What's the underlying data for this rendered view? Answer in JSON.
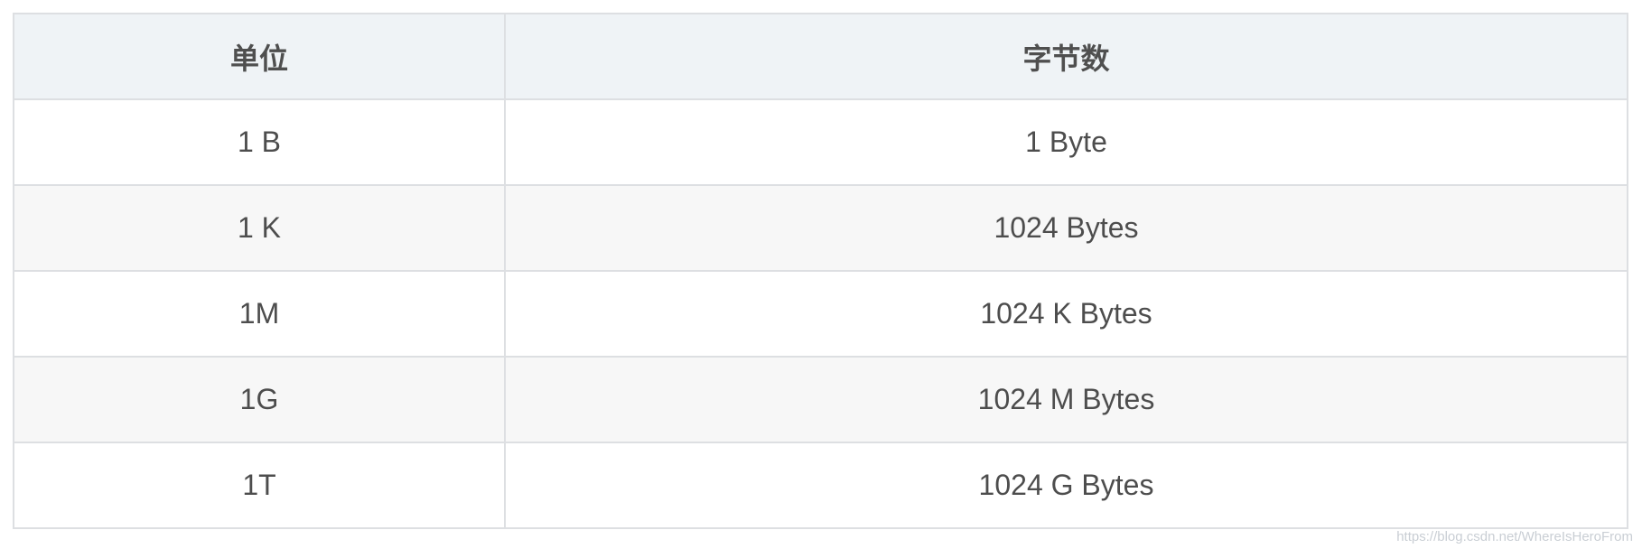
{
  "table": {
    "headers": [
      "单位",
      "字节数"
    ],
    "rows": [
      [
        "1 B",
        "1 Byte"
      ],
      [
        "1 K",
        "1024 Bytes"
      ],
      [
        "1M",
        "1024 K Bytes"
      ],
      [
        "1G",
        "1024 M Bytes"
      ],
      [
        "1T",
        "1024 G Bytes"
      ]
    ]
  },
  "watermark": "https://blog.csdn.net/WhereIsHeroFrom",
  "colors": {
    "header_bg": "#eff3f6",
    "row_alt_bg": "#f7f7f7",
    "border": "#dddfe2",
    "text": "#4d4d4d"
  }
}
